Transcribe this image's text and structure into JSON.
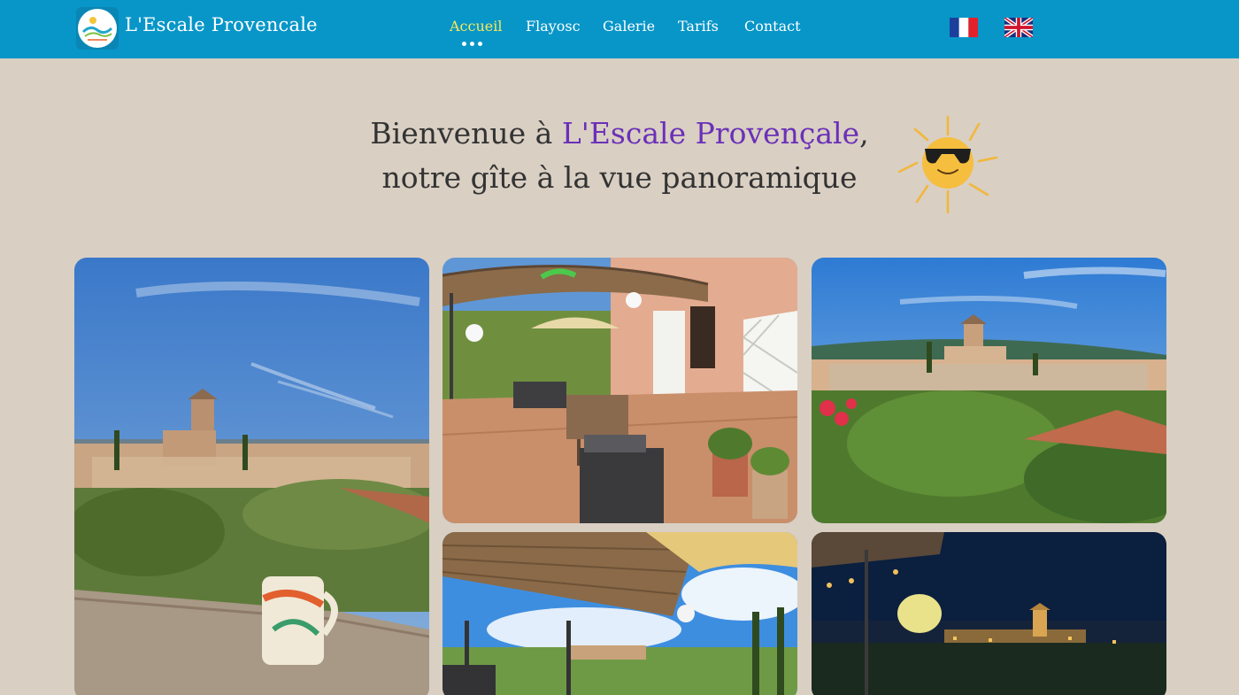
{
  "header": {
    "site_title": "L'Escale Provencale",
    "logo_icon": "escale-provencale-logo",
    "nav": [
      {
        "label": "Accueil",
        "active": true
      },
      {
        "label": "Flayosc",
        "active": false
      },
      {
        "label": "Galerie",
        "active": false
      },
      {
        "label": "Tarifs",
        "active": false
      },
      {
        "label": "Contact",
        "active": false
      }
    ],
    "languages": [
      {
        "code": "fr",
        "icon": "french-flag-icon"
      },
      {
        "code": "en",
        "icon": "uk-flag-icon"
      }
    ]
  },
  "hero": {
    "line1_prefix": "Bienvenue à ",
    "line1_brand": "L'Escale Provençale",
    "line1_suffix": ",",
    "line2": "notre gîte à la vue panoramique",
    "decoration_icon": "sun-with-sunglasses-icon"
  },
  "gallery": [
    {
      "name": "village-view-with-mug-photo"
    },
    {
      "name": "terrace-patio-photo"
    },
    {
      "name": "flayosc-village-panorama-photo"
    },
    {
      "name": "pergola-view-photo"
    },
    {
      "name": "village-by-night-photo"
    }
  ],
  "colors": {
    "header_bg": "#0896c8",
    "page_bg": "#d9cfc3",
    "active_nav": "#f6e85a",
    "brand_accent": "#6b30b8",
    "text": "#333333"
  }
}
